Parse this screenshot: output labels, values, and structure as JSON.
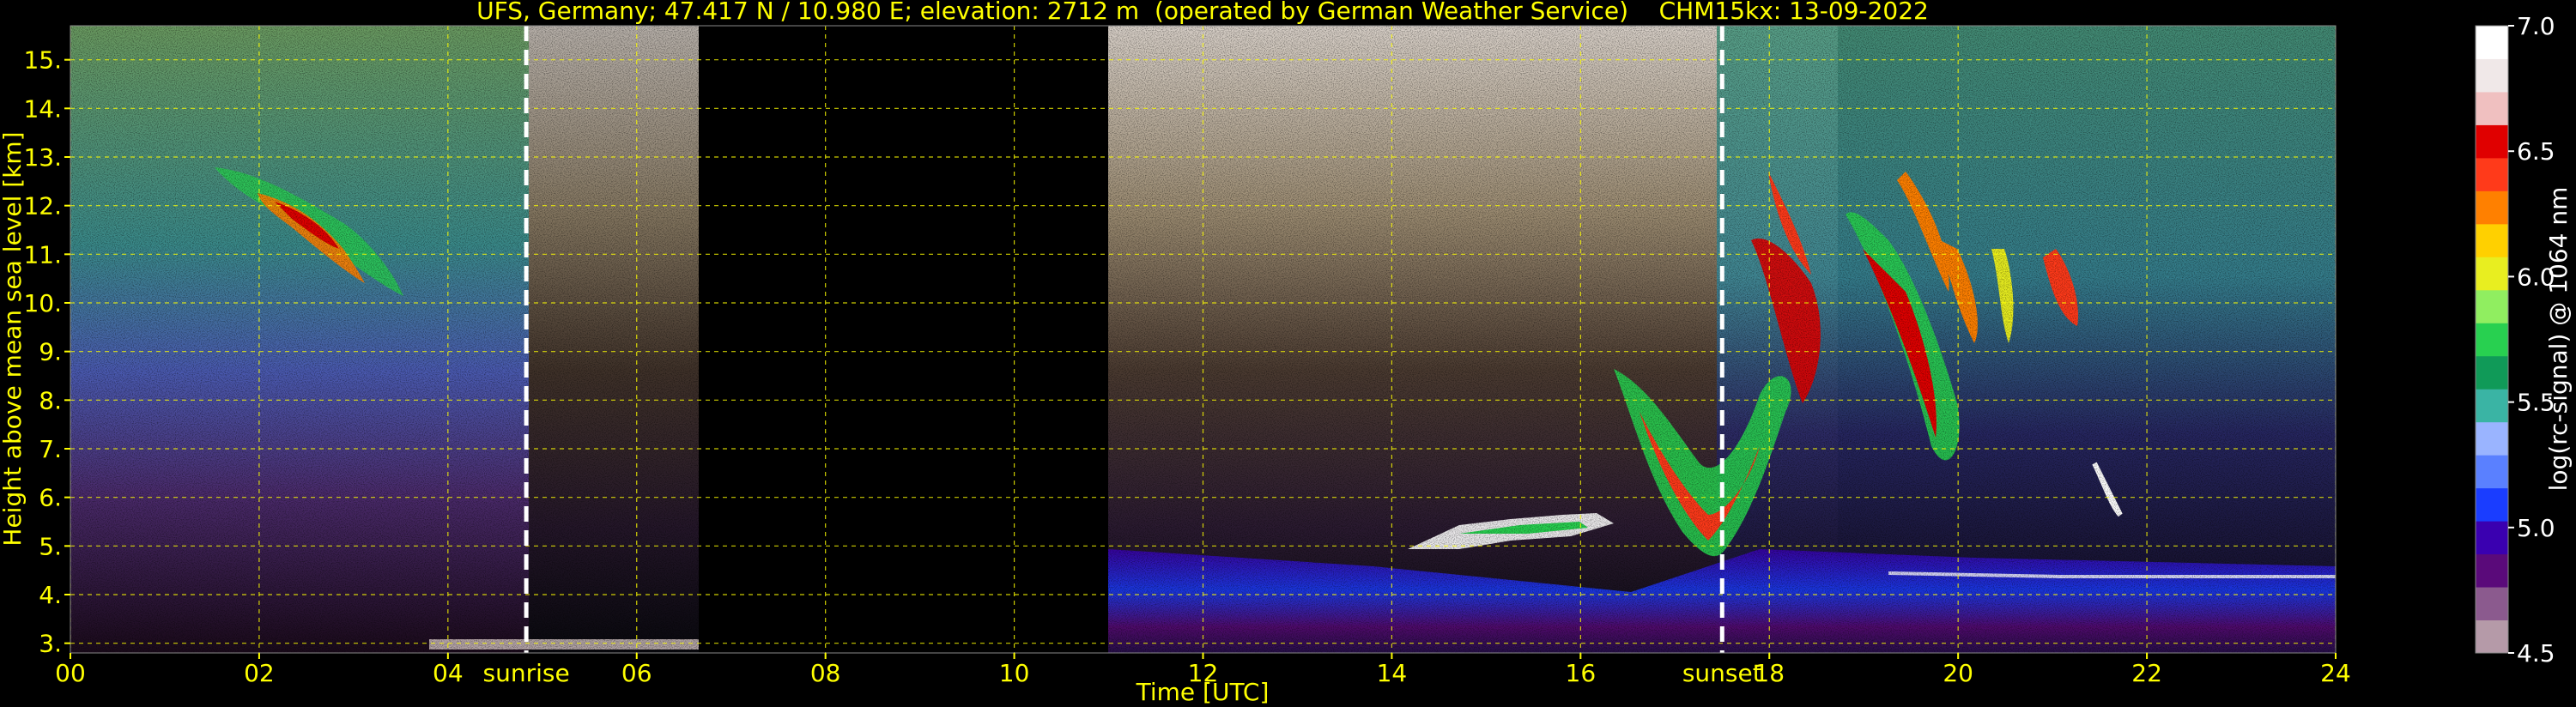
{
  "chart_data": {
    "type": "heatmap",
    "title": "UFS, Germany; 47.417 N / 10.980 E; elevation: 2712 m  (operated by German Weather Service)    CHM15kx: 13-09-2022",
    "xlabel": "Time [UTC]",
    "ylabel": "Height above mean sea level [km]",
    "xlim": [
      0,
      24
    ],
    "ylim": [
      2.8,
      15.7
    ],
    "x_ticks": [
      "00",
      "02",
      "04",
      "06",
      "08",
      "10",
      "12",
      "14",
      "16",
      "18",
      "20",
      "22",
      "24"
    ],
    "y_ticks": [
      "3.",
      "4.",
      "5.",
      "6.",
      "7.",
      "8.",
      "9.",
      "10.",
      "11.",
      "12.",
      "13.",
      "14.",
      "15."
    ],
    "grid": true,
    "no_data_intervals": [
      [
        6.65,
        11.0
      ]
    ],
    "annotations": [
      {
        "label": "sunrise",
        "x": 4.83
      },
      {
        "label": "sunset",
        "x": 17.5
      }
    ],
    "colorbar": {
      "label": "log(rc-signal) @ 1064 nm",
      "range": [
        4.5,
        7.0
      ],
      "ticks": [
        "4.5",
        "5.0",
        "5.5",
        "6.0",
        "6.5",
        "7.0"
      ],
      "colors": [
        "#b59aa8",
        "#8b5a8e",
        "#5a0a7a",
        "#3a00b0",
        "#1a3dff",
        "#5a80ff",
        "#9ab4ff",
        "#3ab4a4",
        "#109a58",
        "#28d050",
        "#90ee60",
        "#e8ee20",
        "#ffd000",
        "#ff8000",
        "#ff3a1a",
        "#e00000",
        "#f0c0c0",
        "#f0e8e8",
        "#ffffff"
      ]
    },
    "features": [
      {
        "kind": "cirrus",
        "x_range": [
          1.5,
          3.4
        ],
        "y_range": [
          10.2,
          13.0
        ]
      },
      {
        "kind": "cirrus",
        "x_range": [
          16.5,
          20.3
        ],
        "y_range": [
          4.6,
          12.5
        ]
      },
      {
        "kind": "mid-level cloud",
        "x_range": [
          14.2,
          15.8
        ],
        "y_range": [
          4.8,
          5.6
        ]
      },
      {
        "kind": "boundary layer aerosol",
        "x_range": [
          11.0,
          24.0
        ],
        "y_range": [
          2.8,
          4.6
        ]
      }
    ]
  }
}
